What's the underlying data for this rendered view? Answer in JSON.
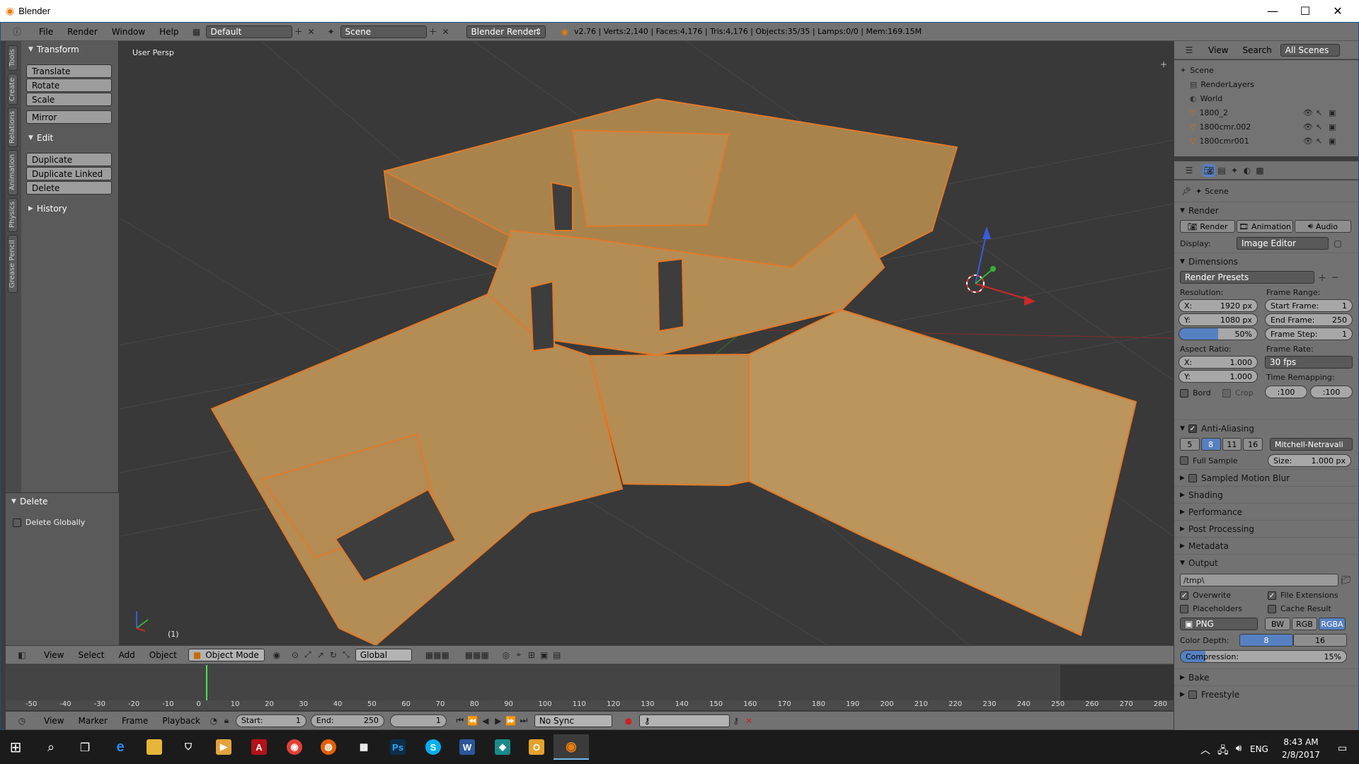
{
  "window": {
    "title": "Blender",
    "controls": {
      "minimize": "—",
      "maximize": "☐",
      "close": "✕"
    }
  },
  "info_header": {
    "menus": [
      "File",
      "Render",
      "Window",
      "Help"
    ],
    "layout": "Default",
    "scene": "Scene",
    "engine": "Blender Render",
    "stats": "v2.76 | Verts:2,140 | Faces:4,176 | Tris:4,176 | Objects:35/35 | Lamps:0/0 | Mem:169.15M"
  },
  "tool_tabs": [
    "Tools",
    "Create",
    "Relations",
    "Animation",
    "Physics",
    "Grease Pencil"
  ],
  "toolshelf": {
    "transform": {
      "title": "Transform",
      "buttons": [
        "Translate",
        "Rotate",
        "Scale"
      ],
      "mirror": "Mirror"
    },
    "edit": {
      "title": "Edit",
      "buttons": [
        "Duplicate",
        "Duplicate Linked",
        "Delete"
      ]
    },
    "history": {
      "title": "History"
    },
    "operator": {
      "title": "Delete",
      "checkbox": "Delete Globally"
    }
  },
  "viewport": {
    "label": "User Persp",
    "frame_indicator": "(1)",
    "colors": {
      "grid": "#4a4a4a",
      "bg": "#393939",
      "wall": "#b8935a",
      "edge": "#e07a2a"
    }
  },
  "view3d_header": {
    "menus": [
      "View",
      "Select",
      "Add",
      "Object"
    ],
    "mode": "Object Mode",
    "orientation": "Global"
  },
  "timeline": {
    "ruler": [
      "-50",
      "-40",
      "-30",
      "-20",
      "-10",
      "0",
      "10",
      "20",
      "30",
      "40",
      "50",
      "60",
      "70",
      "80",
      "90",
      "100",
      "110",
      "120",
      "130",
      "140",
      "150",
      "160",
      "170",
      "180",
      "190",
      "200",
      "210",
      "220",
      "230",
      "240",
      "250",
      "260",
      "270",
      "280"
    ],
    "menus": [
      "View",
      "Marker",
      "Frame",
      "Playback"
    ],
    "start_label": "Start:",
    "start": "1",
    "end_label": "End:",
    "end": "250",
    "current": "1",
    "sync": "No Sync"
  },
  "outliner": {
    "menus": [
      "View",
      "Search"
    ],
    "filter": "All Scenes",
    "items": [
      {
        "label": "Scene",
        "depth": 0,
        "icon": "scene-icon"
      },
      {
        "label": "RenderLayers",
        "depth": 1,
        "icon": "renderlayers-icon"
      },
      {
        "label": "World",
        "depth": 1,
        "icon": "world-icon"
      },
      {
        "label": "1800_2",
        "depth": 1,
        "icon": "object-icon"
      },
      {
        "label": "1800cmr.002",
        "depth": 1,
        "icon": "object-icon"
      },
      {
        "label": "1800cmr001",
        "depth": 1,
        "icon": "object-icon"
      }
    ]
  },
  "properties": {
    "context": "Scene",
    "render": {
      "title": "Render",
      "buttons": [
        "Render",
        "Animation",
        "Audio"
      ],
      "display_label": "Display:",
      "display_value": "Image Editor"
    },
    "dimensions": {
      "title": "Dimensions",
      "presets": "Render Presets",
      "resolution_label": "Resolution:",
      "res_x": "1920 px",
      "res_y": "1080 px",
      "res_pct": "50%",
      "aspect_label": "Aspect Ratio:",
      "asp_x": "1.000",
      "asp_y": "1.000",
      "frame_range_label": "Frame Range:",
      "start_frame": "Start Frame:",
      "start_frame_val": "1",
      "end_frame": "End Frame:",
      "end_frame_val": "250",
      "frame_step": "Frame Step:",
      "frame_step_val": "1",
      "frame_rate_label": "Frame Rate:",
      "frame_rate": "30 fps",
      "time_remap_label": "Time Remapping:",
      "remap_old": ":100",
      "remap_new": ":100",
      "bord": "Bord",
      "crop": "Crop",
      "x_lbl": "X:",
      "y_lbl": "Y:"
    },
    "antialiasing": {
      "title": "Anti-Aliasing",
      "samples": [
        "5",
        "8",
        "11",
        "16"
      ],
      "filter": "Mitchell-Netravali",
      "full_sample": "Full Sample",
      "size_label": "Size:",
      "size": "1.000 px"
    },
    "collapsed": [
      "Sampled Motion Blur",
      "Shading",
      "Performance",
      "Post Processing",
      "Metadata"
    ],
    "output": {
      "title": "Output",
      "path": "/tmp\\",
      "overwrite": "Overwrite",
      "file_ext": "File Extensions",
      "placeholders": "Placeholders",
      "cache": "Cache Result",
      "format": "PNG",
      "channels": [
        "BW",
        "RGB",
        "RGBA"
      ],
      "depth_label": "Color Depth:",
      "depth": [
        "8",
        "16"
      ],
      "compression_label": "Compression:",
      "compression": "15%",
      "compression_value": 0.15
    },
    "bake": "Bake",
    "freestyle": "Freestyle"
  },
  "taskbar": {
    "lang": "ENG",
    "time": "8:43 AM",
    "date": "2/8/2017"
  }
}
